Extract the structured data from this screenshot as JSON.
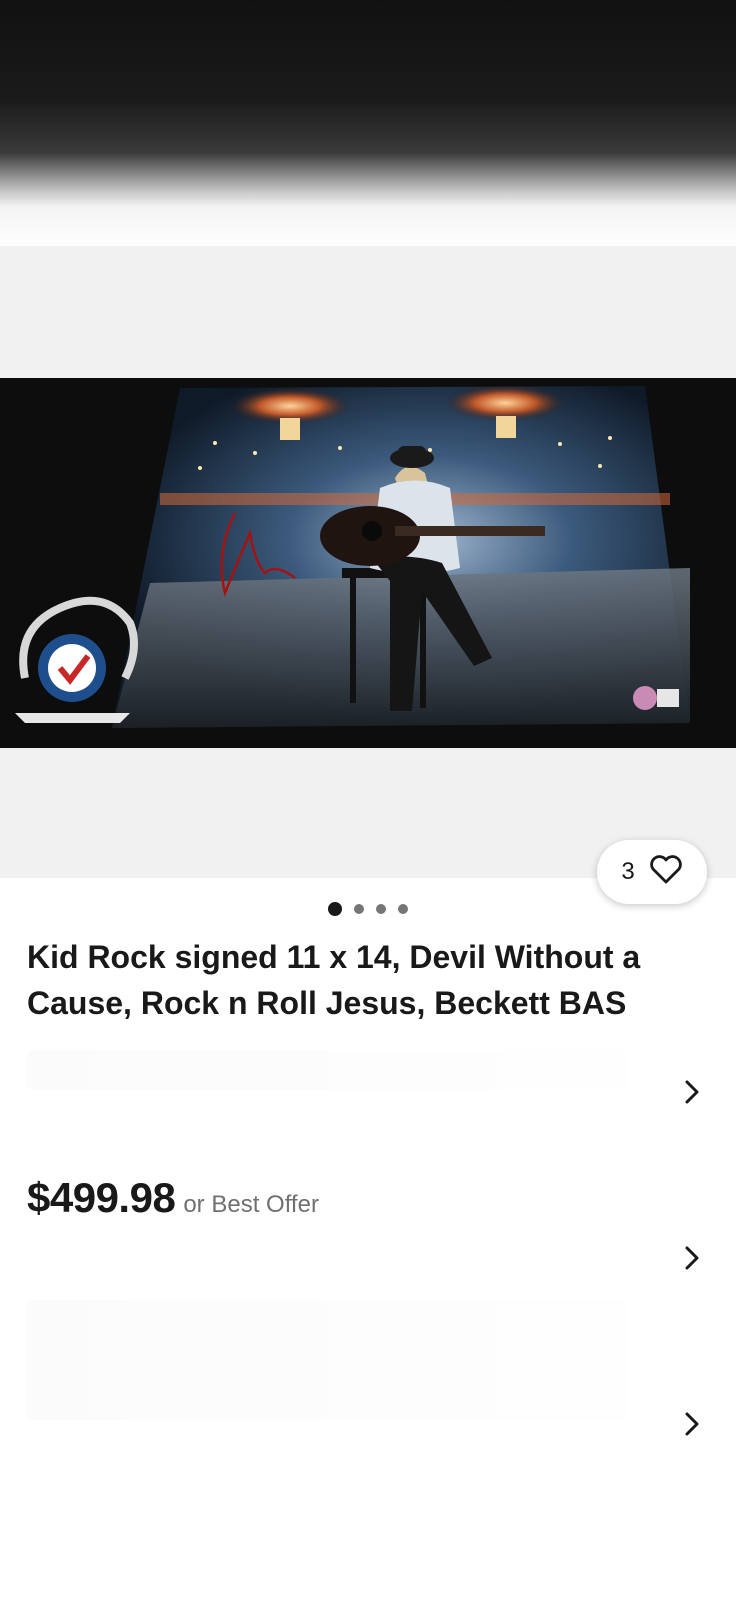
{
  "listing": {
    "title": "Kid Rock signed 11 x 14, Devil Without a Cause, Rock n Roll Jesus, Beckett BAS",
    "price": "$499.98",
    "offer_text": "or Best Offer"
  },
  "gallery": {
    "watch_count": "3",
    "page_count": 4,
    "active_page": 1
  },
  "icons": {
    "watch": "heart-icon",
    "row_arrow": "chevron-right-icon"
  },
  "colors": {
    "text": "#191919",
    "muted": "#707070",
    "gallery_bg": "#f1f1f1"
  }
}
